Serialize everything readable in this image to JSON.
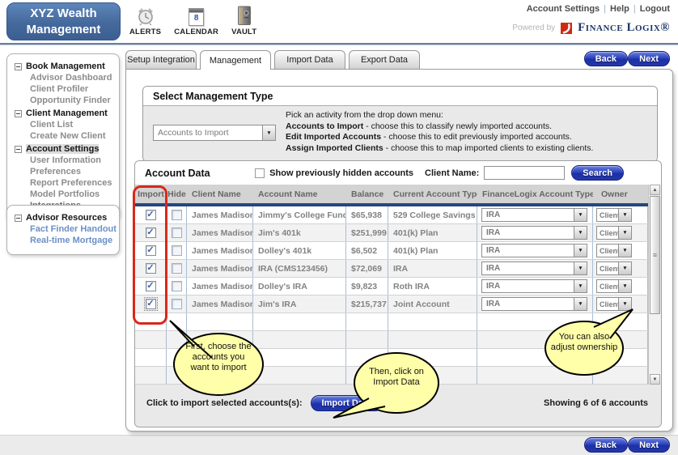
{
  "header": {
    "logo_line1": "XYZ Wealth",
    "logo_line2": "Management",
    "icons": [
      {
        "label": "ALERTS"
      },
      {
        "label": "CALENDAR",
        "day": "8"
      },
      {
        "label": "VAULT"
      }
    ],
    "links": {
      "account_settings": "Account Settings",
      "help": "Help",
      "logout": "Logout"
    },
    "powered_by": "Powered by",
    "brand": "Finance Logix®"
  },
  "sidebar": {
    "sections": [
      {
        "title": "Book Management",
        "items": [
          "Advisor Dashboard",
          "Client Profiler",
          "Opportunity Finder"
        ]
      },
      {
        "title": "Client Management",
        "items": [
          "Client List",
          "Create New Client"
        ]
      },
      {
        "title": "Account Settings",
        "items": [
          "User Information",
          "Preferences",
          "Report Preferences",
          "Model Portfolios",
          "Integrations"
        ]
      }
    ],
    "resources": {
      "title": "Advisor Resources",
      "links": [
        "Fact Finder Handout",
        "Real-time Mortgage"
      ]
    }
  },
  "tabs": [
    {
      "label": "Setup Integration"
    },
    {
      "label": "Management"
    },
    {
      "label": "Import Data"
    },
    {
      "label": "Export Data"
    }
  ],
  "nav": {
    "back": "Back",
    "next": "Next"
  },
  "management_type": {
    "title": "Select Management Type",
    "dropdown_value": "Accounts to Import",
    "intro": "Pick an activity from the drop down menu:",
    "options": [
      {
        "name": "Accounts to Import",
        "desc": " - choose this to classify newly imported accounts."
      },
      {
        "name": "Edit Imported Accounts",
        "desc": " - choose this to edit previously imported accounts."
      },
      {
        "name": "Assign Imported Clients",
        "desc": " - choose this to map imported clients to existing clients."
      }
    ]
  },
  "account_data": {
    "title": "Account Data",
    "show_hidden_label": "Show previously hidden accounts",
    "client_name_label": "Client Name:",
    "search_label": "Search",
    "columns": [
      "Import",
      "Hide",
      "Client Name",
      "Account Name",
      "Balance",
      "Current Account Type",
      "FinanceLogix Account Type",
      "Owner"
    ],
    "rows": [
      {
        "import": true,
        "hide": false,
        "client": "James Madison",
        "account": "Jimmy's College Fund",
        "balance": "$65,938",
        "current_type": "529 College Savings",
        "fl_type": "IRA",
        "owner": "Client"
      },
      {
        "import": true,
        "hide": false,
        "client": "James Madison",
        "account": "Jim's 401k",
        "balance": "$251,999",
        "current_type": "401(k) Plan",
        "fl_type": "IRA",
        "owner": "Client"
      },
      {
        "import": true,
        "hide": false,
        "client": "James Madison",
        "account": "Dolley's 401k",
        "balance": "$6,502",
        "current_type": "401(k) Plan",
        "fl_type": "IRA",
        "owner": "Client"
      },
      {
        "import": true,
        "hide": false,
        "client": "James Madison",
        "account": "IRA (CMS123456)",
        "balance": "$72,069",
        "current_type": "IRA",
        "fl_type": "IRA",
        "owner": "Client"
      },
      {
        "import": true,
        "hide": false,
        "client": "James Madison",
        "account": "Dolley's IRA",
        "balance": "$9,823",
        "current_type": "Roth IRA",
        "fl_type": "IRA",
        "owner": "Client"
      },
      {
        "import": true,
        "hide": false,
        "client": "James Madison",
        "account": "Jim's IRA",
        "balance": "$215,737",
        "current_type": "Joint Account",
        "fl_type": "IRA",
        "owner": "Client"
      }
    ],
    "footer": {
      "import_prompt": "Click to import selected accounts(s):",
      "import_button": "Import Data",
      "showing": "Showing 6 of 6 accounts"
    }
  },
  "callouts": [
    {
      "text": "First, choose the accounts you want to import"
    },
    {
      "text": "Then, click on Import Data"
    },
    {
      "text": "You can also adjust ownership"
    }
  ],
  "colors": {
    "accent_blue": "#2338ae",
    "header_blue": "#45699c",
    "divider_navy": "#26477f",
    "brand_navy": "#1c3666",
    "brand_red": "#ce2a12",
    "callout_yellow": "#ffffa9",
    "annotation_red": "#d8291a"
  }
}
